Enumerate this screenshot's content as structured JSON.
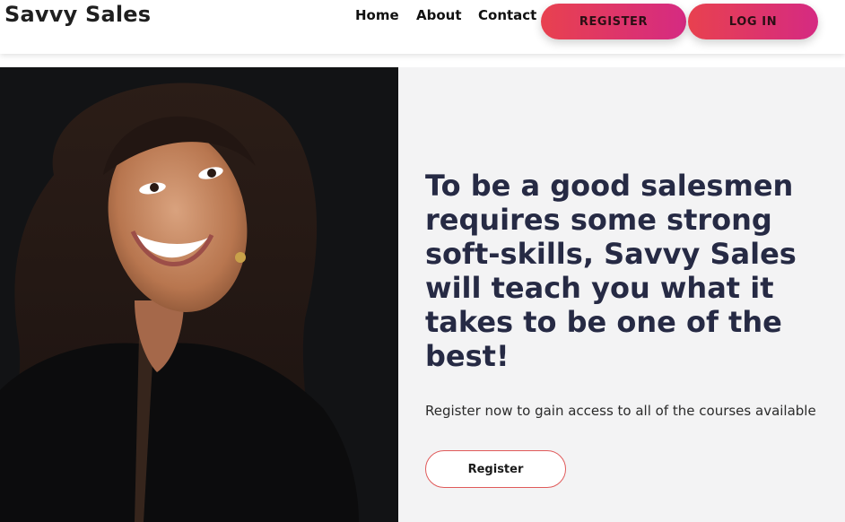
{
  "header": {
    "brand": "Savvy Sales",
    "nav": [
      {
        "label": "Home"
      },
      {
        "label": "About"
      },
      {
        "label": "Contact"
      }
    ],
    "register_label": "REGISTER",
    "login_label": "LOG IN"
  },
  "hero": {
    "headline": "To be a good salesmen requires some strong soft-skills, Savvy Sales will teach you what it takes to be one of the best!",
    "subtext": "Register now to gain access to all of the courses available",
    "cta_label": "Register"
  },
  "colors": {
    "accent_gradient_start": "#e8414f",
    "accent_gradient_end": "#d52a82",
    "headline": "#262a44"
  }
}
